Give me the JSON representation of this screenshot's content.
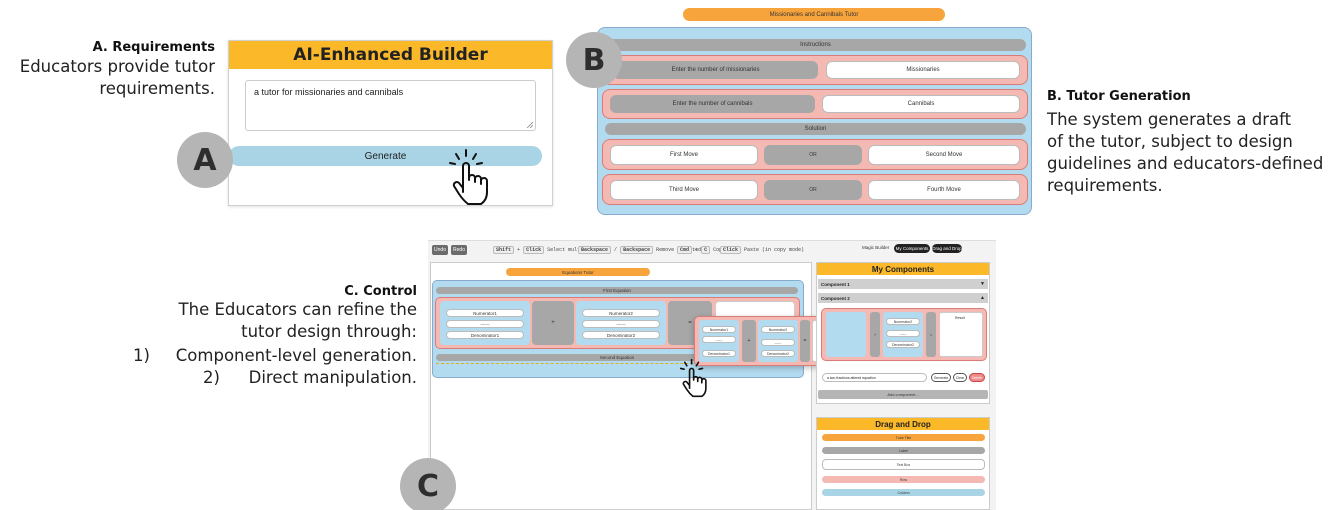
{
  "panel_a": {
    "caption_title": "A. Requirements",
    "caption_text": [
      "Educators provide tutor",
      "requirements."
    ],
    "builder_title": "AI-Enhanced Builder",
    "prompt_value": "a tutor for missionaries and cannibals",
    "generate_label": "Generate",
    "badge": "A"
  },
  "panel_b": {
    "badge": "B",
    "caption_title": "B. Tutor Generation",
    "caption_text": [
      "The system generates a draft",
      "of the tutor, subject to design",
      "guidelines and educators-defined",
      "requirements."
    ],
    "tutor_title": "Missionaries and Cannibals Tutor",
    "instructions": "Instructions",
    "enter_missionaries": "Enter the number of missionaries",
    "missionaries": "Missionaries",
    "enter_cannibals": "Enter the number of cannibals",
    "cannibals": "Cannibals",
    "solution": "Solution",
    "first_move": "First Move",
    "or1": "OR",
    "second_move": "Second Move",
    "third_move": "Third Move",
    "or2": "OR",
    "fourth_move": "Fourth Move"
  },
  "panel_c": {
    "badge": "C",
    "caption_title": "C. Control",
    "caption_lines": [
      "The Educators can refine the",
      "tutor design through:"
    ],
    "items": [
      {
        "num": "1)",
        "text": "Component-level generation."
      },
      {
        "num": "2)",
        "text": "Direct manipulation."
      }
    ],
    "toolbar": {
      "undo": "Undo",
      "redo": "Redo",
      "shortcuts": [
        {
          "keys": [
            "Shift",
            "+",
            "Click"
          ],
          "desc": "Select multiple"
        },
        {
          "keys": [
            "Backspace",
            "/",
            "Backspace"
          ],
          "desc": "Remove selected"
        },
        {
          "keys": [
            "Cmd",
            "+",
            "C"
          ],
          "desc": "Copy"
        },
        {
          "keys": [
            "Click"
          ],
          "desc": "Paste (in copy mode)"
        }
      ]
    },
    "mode_tabs": {
      "magic": "Magic Builder",
      "my_components": "My Components",
      "drag_drop": "Drag and Drop"
    },
    "canvas": {
      "title": "Equations Tutor",
      "first_equation": "First Equation",
      "numerator1": "Numerator1",
      "dash1": "------",
      "denominator1": "Denominator1",
      "plus": "+",
      "numerator2": "Numerator2",
      "dash2": "------",
      "denominator2": "Denominator2",
      "equals": "=",
      "second_equation": "Second Equation"
    },
    "drag_preview": {
      "numerator1": "Numerator1",
      "dash1": "------",
      "denominator1": "Denominator1",
      "plus": "+",
      "numerator2": "Numerator2",
      "dash2": "------",
      "denominator2": "Denominator2",
      "equals": "=",
      "result": "Result"
    },
    "my_components": {
      "title": "My Components",
      "component1": "Component 1",
      "component2": "Component 2",
      "arrow_collapsed": "▼",
      "arrow_expanded": "▲",
      "numerator2": "Numerator2",
      "dash": "------",
      "denominator2": "Denominator2",
      "plus": "+",
      "equals": "=",
      "result": "Result",
      "prompt_value": "a two fractions altered equation",
      "generate": "Generate",
      "clear": "Clear",
      "delete": "Delete",
      "add_component": "Add component..."
    },
    "drag_and_drop": {
      "title": "Drag and Drop",
      "items": [
        "Tutor Title",
        "Label",
        "Text Box",
        "Row",
        "Column"
      ]
    }
  },
  "colors": {
    "orange": "#f7a43d",
    "gold": "#fbb829",
    "blue": "#a8d4e6",
    "pink": "#f4b9b3",
    "gray": "#a7a7a7",
    "badge_gray": "#b5b5b5"
  }
}
